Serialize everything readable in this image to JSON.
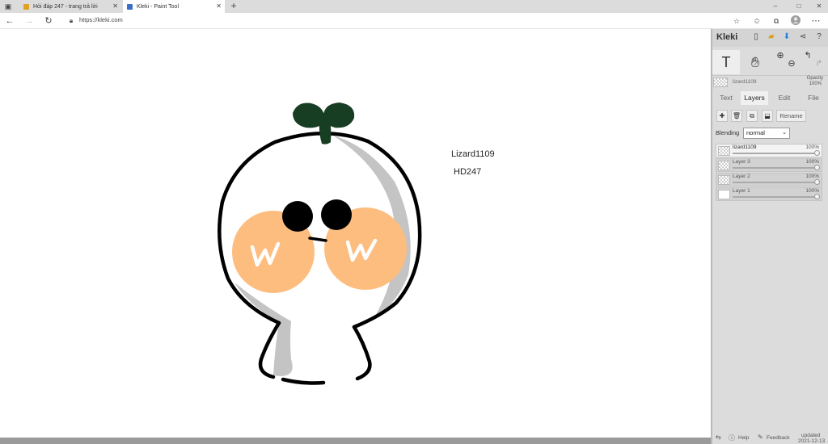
{
  "browser": {
    "tabs": [
      {
        "title": "Hỏi đáp 247 - trang trả lời",
        "active": false,
        "favicon_color": "#e0a020"
      },
      {
        "title": "Kleki - Paint Tool",
        "active": true,
        "favicon_color": "#3a6ec8"
      }
    ],
    "new_tab_label": "+",
    "url": "https://kleki.com",
    "window_controls": [
      "–",
      "□",
      "✕"
    ]
  },
  "canvas": {
    "texts": [
      {
        "text": "Lizard1109"
      },
      {
        "text": "HD247"
      }
    ],
    "colors": {
      "sprout": "#173d22",
      "cheek": "#fdbd7f",
      "shadow": "#c4c4c4",
      "outline": "#000000"
    }
  },
  "panel": {
    "brand": "Kleki",
    "current_layer_name": "lizard1109",
    "opacity_label": "Opacity",
    "opacity_value": "100%",
    "tabs": [
      "Text",
      "Layers",
      "Edit",
      "File"
    ],
    "active_tab": "Layers",
    "rename_label": "Rename",
    "blending_label": "Blending",
    "blending_value": "normal",
    "layers": [
      {
        "name": "lizard1109",
        "opacity": "100%",
        "selected": true
      },
      {
        "name": "Layer 3",
        "opacity": "100%",
        "selected": false
      },
      {
        "name": "Layer 2",
        "opacity": "100%",
        "selected": false
      },
      {
        "name": "Layer 1",
        "opacity": "100%",
        "selected": false
      }
    ],
    "footer": {
      "help": "Help",
      "feedback": "Feedback",
      "updated": "updated",
      "date": "2021-12-13"
    }
  }
}
